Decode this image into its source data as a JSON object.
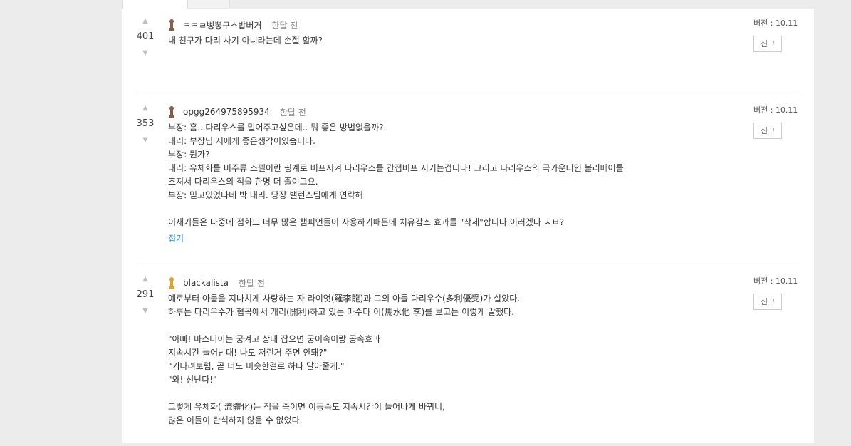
{
  "colors": {
    "background": "#ececec",
    "panel": "#ffffff",
    "link": "#1f8ecd",
    "badge_brown": "#8b5a4a",
    "badge_gold": "#e6a31f"
  },
  "icons": {
    "upvote": "upvote-arrow-icon",
    "downvote": "downvote-arrow-icon",
    "badge": "tier-badge-icon"
  },
  "comments": [
    {
      "score": "401",
      "author": "ㅋㅋㄹ삥뽕구스밥버거",
      "time": "한달 전",
      "version": "버전 : 10.11",
      "report": "신고",
      "text": "내 친구가 다리 사기 아니라는데 손절 할까?"
    },
    {
      "score": "353",
      "author": "opgg264975895934",
      "time": "한달 전",
      "version": "버전 : 10.11",
      "report": "신고",
      "text": "부장: 흠...다리우스를 밀어주고싶은데.. 뭐 좋은 방법없을까?\n대리: 부장님 저에게 좋은생각이있습니다.\n부장: 뭔가?\n대리: 유체화를 비주류 스펠이란 핑계로 버프시켜 다리우스를 간접버프 시키는겁니다! 그리고 다리우스의 극카운터인 볼리베어를\n조져서 다리우스의 적을 한명 더 줄이고요.\n부장: 믿고있었다네 박 대리. 당장 밸런스팀에게 연락해\n\n이새기들은 나중에 점화도 너무 많은 챔피언들이 사용하기때문에 치유감소 효과를 \"삭제\"합니다 이러겠다 ㅅㅂ?",
      "fold": "접기"
    },
    {
      "score": "291",
      "author": "blackalista",
      "time": "한달 전",
      "version": "버전 : 10.11",
      "report": "신고",
      "text": "예로부터 아들을 지나치게 사랑하는 자 라이엇(羅李龍)과 그의 아들 다리우수(多利優受)가 살았다.\n하루는 다리우수가 협곡에서 캐리(開利)하고 있는 마수타 이(馬水他 李)를 보고는 이렇게 말했다.\n\n\"아빠! 마스터이는 궁켜고 상대 잡으면 궁이속이랑 공속효과\n지속시간 늘어난대! 나도 저런거 주면 안돼?\"\n\"기다려보렴, 곧 너도 비슷한걸로 하나 달아줄게.\"\n\"와! 신난다!\"\n\n그렇게 유체화( 流體化)는 적을 죽이면 이동속도 지속시간이 늘어나게 바뀌니,\n많은 이들이 탄식하지 않을 수 없었다."
    }
  ]
}
